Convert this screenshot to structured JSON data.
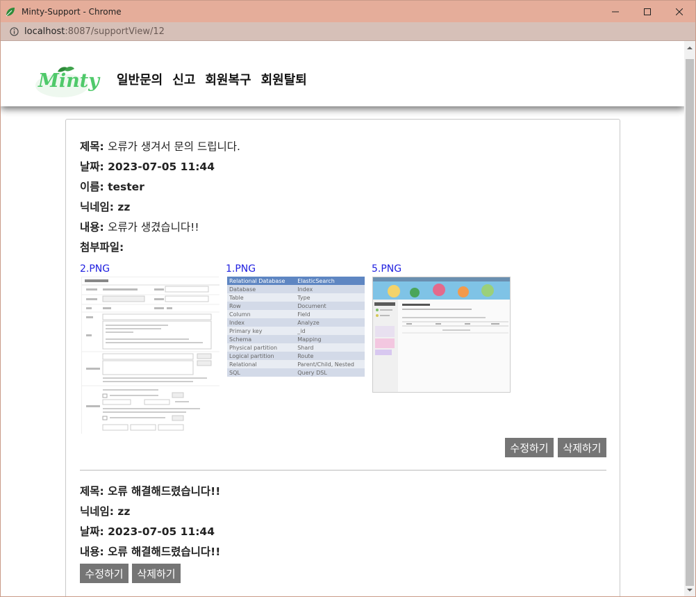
{
  "window": {
    "title": "Minty-Support - Chrome",
    "url_host": "localhost",
    "url_path": ":8087/supportView/12"
  },
  "header": {
    "logo_text": "Minty",
    "nav": [
      "일반문의",
      "신고",
      "회원복구",
      "회원탈퇴"
    ]
  },
  "inquiry": {
    "title_label": "제목: ",
    "title_value": "오류가 생겨서 문의 드립니다.",
    "date_label": "날짜: ",
    "date_value": "2023-07-05 11:44",
    "name_label": "이름: ",
    "name_value": "tester",
    "nickname_label": "닉네임: ",
    "nickname_value": "zz",
    "content_label": "내용: ",
    "content_value": "오류가 생겼습니다!!",
    "attachments_label": "첨부파일:",
    "attachments": [
      "2.PNG",
      "1.PNG",
      "5.PNG"
    ],
    "edit_label": "수정하기",
    "delete_label": "삭제하기"
  },
  "attachment_1_table": {
    "headers": [
      "Relational Database",
      "ElasticSearch"
    ],
    "rows": [
      [
        "Database",
        "Index"
      ],
      [
        "Table",
        "Type"
      ],
      [
        "Row",
        "Document"
      ],
      [
        "Column",
        "Field"
      ],
      [
        "Index",
        "Analyze"
      ],
      [
        "Primary key",
        "_id"
      ],
      [
        "Schema",
        "Mapping"
      ],
      [
        "Physical partition",
        "Shard"
      ],
      [
        "Logical partition",
        "Route"
      ],
      [
        "Relational",
        "Parent/Child, Nested"
      ],
      [
        "SQL",
        "Query DSL"
      ]
    ]
  },
  "reply": {
    "title_label": "제목: ",
    "title_value": "오류 해결해드렸습니다!!",
    "nickname_label": "닉네임: ",
    "nickname_value": "zz",
    "date_label": "날짜: ",
    "date_value": "2023-07-05 11:44",
    "content_label": "내용: ",
    "content_value": "오류 해결해드렸습니다!!",
    "edit_label": "수정하기",
    "delete_label": "삭제하기"
  },
  "colors": {
    "titlebar": "#e5ad9a",
    "addressbar": "#d6c0b8",
    "logo_green": "#4fc96a",
    "link_blue": "#2020e0",
    "button_gray": "#757575"
  }
}
